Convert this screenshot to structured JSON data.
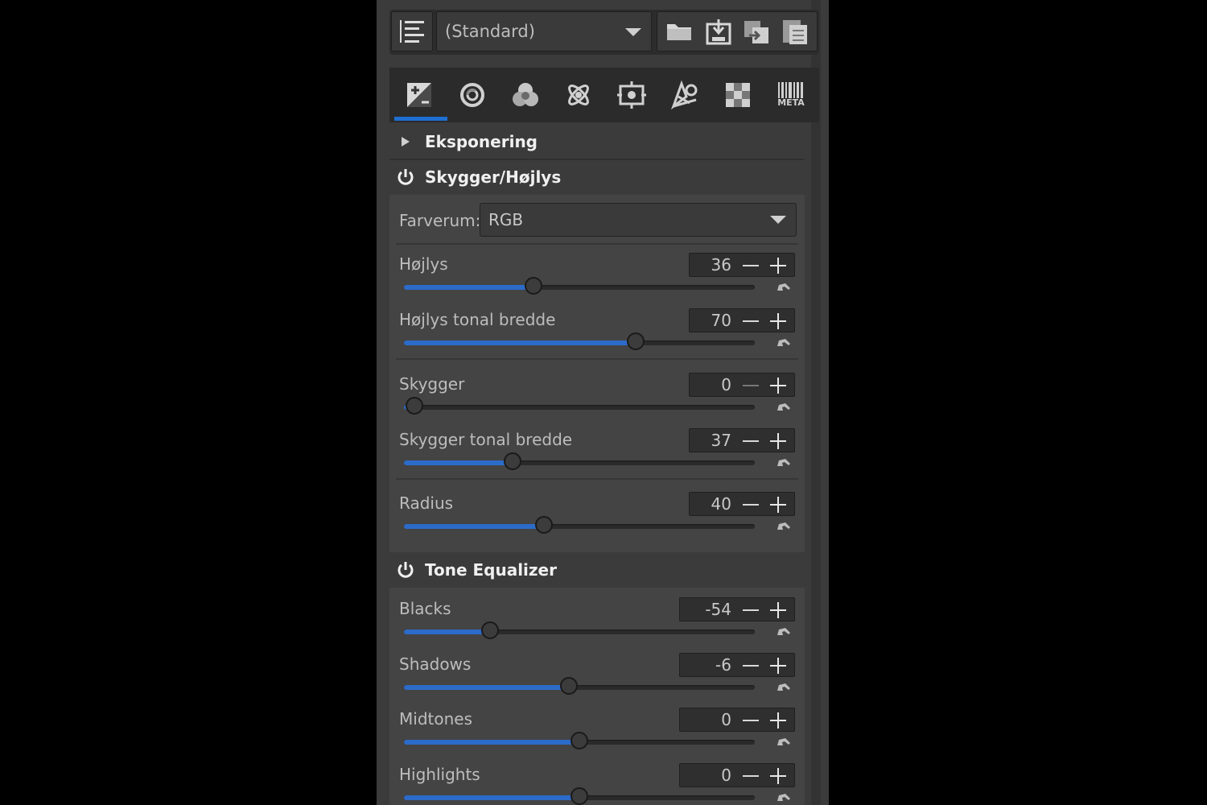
{
  "toolbar": {
    "profile_selected": "(Standard)"
  },
  "tabs": [
    {
      "name": "exposure-tab",
      "icon": "exposure-icon",
      "active": true
    },
    {
      "name": "detail-tab",
      "icon": "detail-icon"
    },
    {
      "name": "color-tab",
      "icon": "color-circles-icon"
    },
    {
      "name": "advanced-tab",
      "icon": "atom-icon"
    },
    {
      "name": "transform-tab",
      "icon": "crop-icon"
    },
    {
      "name": "raw-tab",
      "icon": "aperture-icon"
    },
    {
      "name": "local-tab",
      "icon": "checker-icon"
    },
    {
      "name": "meta-tab",
      "icon": "meta-barcode-icon",
      "label": "META"
    }
  ],
  "sections": {
    "exposure": {
      "title": "Eksponering"
    },
    "shadows_highlights": {
      "title": "Skygger/Højlys",
      "colorspace_label": "Farverum:",
      "colorspace_value": "RGB",
      "sliders": [
        {
          "label": "Højlys",
          "value": "36",
          "fraction": 0.37
        },
        {
          "label": "Højlys tonal bredde",
          "value": "70",
          "fraction": 0.66
        },
        {
          "label": "Skygger",
          "value": "0",
          "fraction": 0.03
        },
        {
          "label": "Skygger tonal bredde",
          "value": "37",
          "fraction": 0.31
        },
        {
          "label": "Radius",
          "value": "40",
          "fraction": 0.4
        }
      ]
    },
    "tone_equalizer": {
      "title": "Tone Equalizer",
      "sliders": [
        {
          "label": "Blacks",
          "value": "-54",
          "fraction": 0.245
        },
        {
          "label": "Shadows",
          "value": "-6",
          "fraction": 0.47
        },
        {
          "label": "Midtones",
          "value": "0",
          "fraction": 0.5
        },
        {
          "label": "Highlights",
          "value": "0",
          "fraction": 0.5
        }
      ]
    }
  },
  "colors": {
    "accent": "#2c6bc9",
    "panel": "#3b3b3b",
    "body": "#444444"
  }
}
